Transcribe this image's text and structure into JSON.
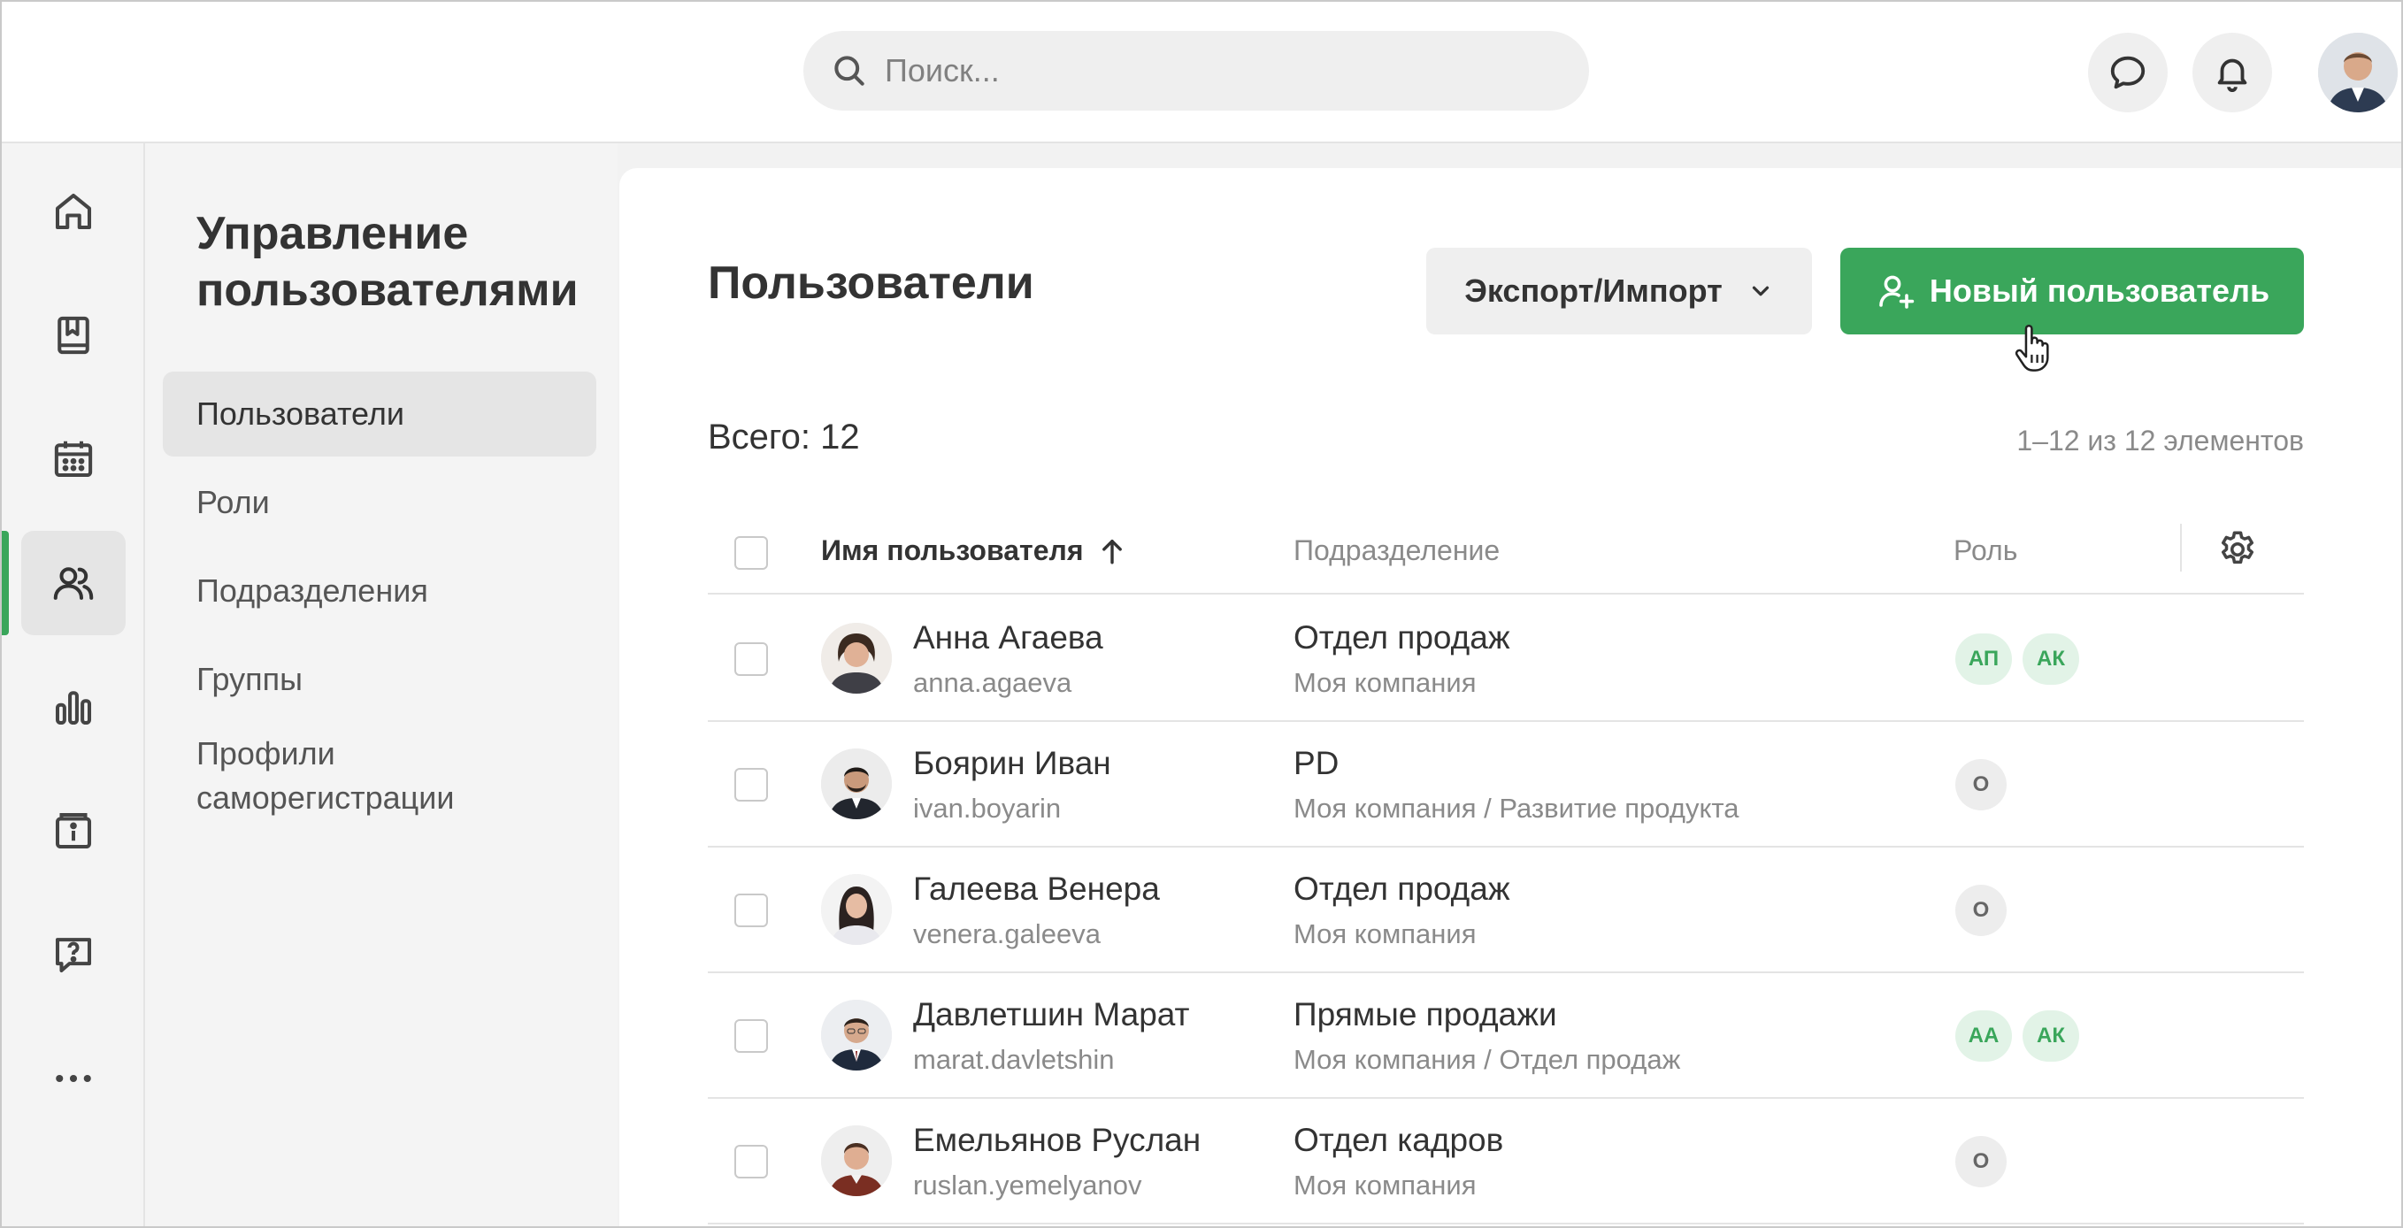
{
  "colors": {
    "accent": "#3aa65b",
    "badge_green_bg": "#e2f3e7",
    "badge_gray_bg": "#ededed"
  },
  "header": {
    "search_placeholder": "Поиск...",
    "icons": [
      "search-icon",
      "chat-icon",
      "bell-icon",
      "user-avatar"
    ]
  },
  "rail": {
    "items": [
      {
        "icon": "home-icon"
      },
      {
        "icon": "book-icon"
      },
      {
        "icon": "calendar-icon"
      },
      {
        "icon": "users-icon",
        "active": true
      },
      {
        "icon": "chart-icon"
      },
      {
        "icon": "info-box-icon"
      },
      {
        "icon": "help-icon"
      },
      {
        "icon": "more-icon"
      }
    ]
  },
  "subnav": {
    "title": "Управление пользователями",
    "items": [
      {
        "label": "Пользователи",
        "active": true
      },
      {
        "label": "Роли"
      },
      {
        "label": "Подразделения"
      },
      {
        "label": "Группы"
      },
      {
        "label": "Профили саморегистрации"
      }
    ]
  },
  "main": {
    "title": "Пользователи",
    "export_label": "Экспорт/Импорт",
    "new_user_label": "Новый пользователь",
    "total": "Всего: 12",
    "pager": "1–12 из 12 элементов",
    "columns": {
      "name": "Имя пользователя",
      "department": "Подразделение",
      "role": "Роль"
    },
    "rows": [
      {
        "name": "Анна Агаева",
        "login": "anna.agaeva",
        "dept": "Отдел продаж",
        "path": "Моя компания",
        "roles": [
          "АП",
          "АК"
        ],
        "role_style": "green"
      },
      {
        "name": "Боярин Иван",
        "login": "ivan.boyarin",
        "dept": "PD",
        "path": "Моя компания / Развитие продукта",
        "roles": [
          "О"
        ],
        "role_style": "gray"
      },
      {
        "name": "Галеева Венера",
        "login": "venera.galeeva",
        "dept": "Отдел продаж",
        "path": "Моя компания",
        "roles": [
          "О"
        ],
        "role_style": "gray"
      },
      {
        "name": "Давлетшин Марат",
        "login": "marat.davletshin",
        "dept": "Прямые продажи",
        "path": "Моя компания / Отдел продаж",
        "roles": [
          "АА",
          "АК"
        ],
        "role_style": "green"
      },
      {
        "name": "Емельянов Руслан",
        "login": "ruslan.yemelyanov",
        "dept": "Отдел кадров",
        "path": "Моя компания",
        "roles": [
          "О"
        ],
        "role_style": "gray"
      }
    ]
  }
}
